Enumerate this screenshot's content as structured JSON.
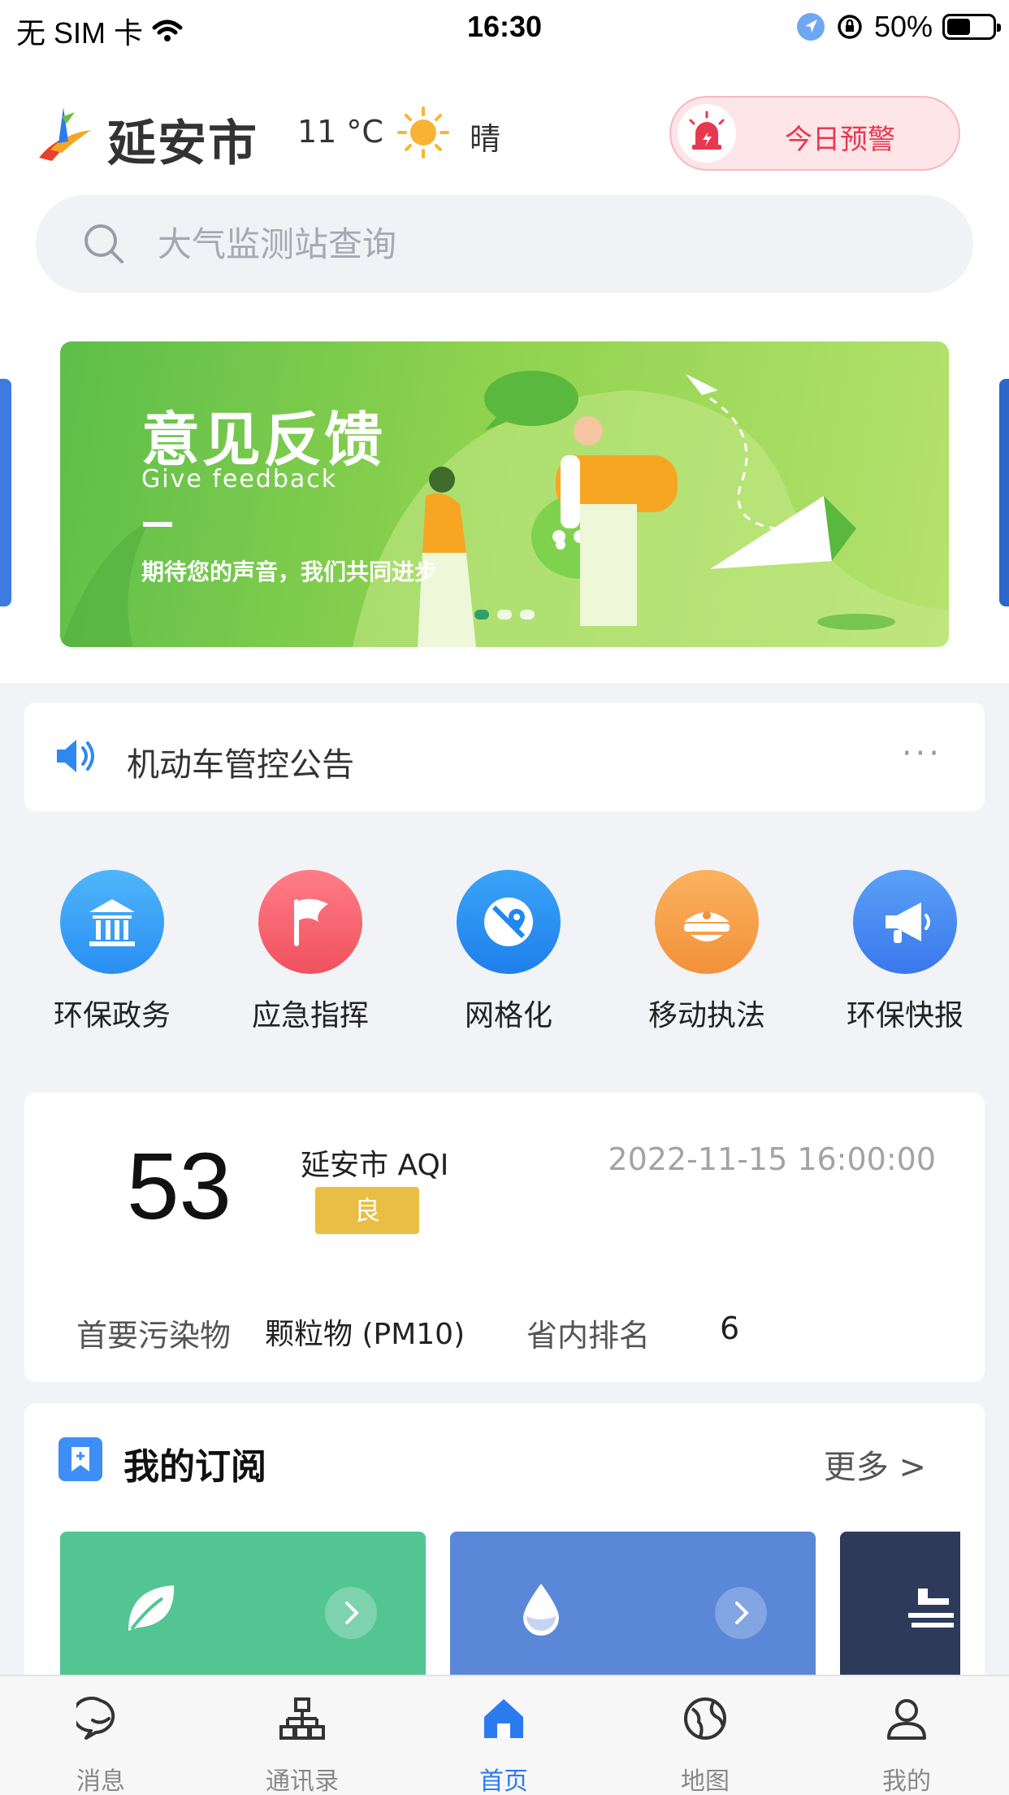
{
  "status_bar": {
    "carrier": "无 SIM 卡",
    "time": "16:30",
    "battery": "50%"
  },
  "header": {
    "city": "延安市",
    "temperature": "11 °C",
    "weather": "晴",
    "alert_label": "今日预警"
  },
  "search": {
    "placeholder": "大气监测站查询"
  },
  "banner": {
    "title": "意见反馈",
    "subtitle": "Give feedback",
    "slogan": "期待您的声音，我们共同进步"
  },
  "notice": {
    "text": "机动车管控公告",
    "more": "···"
  },
  "apps": [
    {
      "label": "环保政务",
      "icon": "government-building-icon",
      "color": "#3E9CF5"
    },
    {
      "label": "应急指挥",
      "icon": "flag-icon",
      "color": "#F5616F"
    },
    {
      "label": "网格化",
      "icon": "map-pin-icon",
      "color": "#2C8DF0"
    },
    {
      "label": "移动执法",
      "icon": "officer-cap-icon",
      "color": "#F4A24E"
    },
    {
      "label": "环保快报",
      "icon": "megaphone-icon",
      "color": "#4D8CF2"
    }
  ],
  "aqi": {
    "value": "53",
    "city_label": "延安市 AQI",
    "level": "良",
    "timestamp": "2022-11-15 16:00:00",
    "primary_pollutant_label": "首要污染物",
    "primary_pollutant": "颗粒物 (PM10)",
    "rank_label": "省内排名",
    "rank": "6"
  },
  "subscriptions": {
    "title": "我的订阅",
    "more": "更多 >"
  },
  "tabbar": [
    {
      "label": "消息",
      "icon": "chat-bubble-icon"
    },
    {
      "label": "通讯录",
      "icon": "org-chart-icon"
    },
    {
      "label": "首页",
      "icon": "home-icon",
      "active": true
    },
    {
      "label": "地图",
      "icon": "globe-icon"
    },
    {
      "label": "我的",
      "icon": "user-icon"
    }
  ]
}
